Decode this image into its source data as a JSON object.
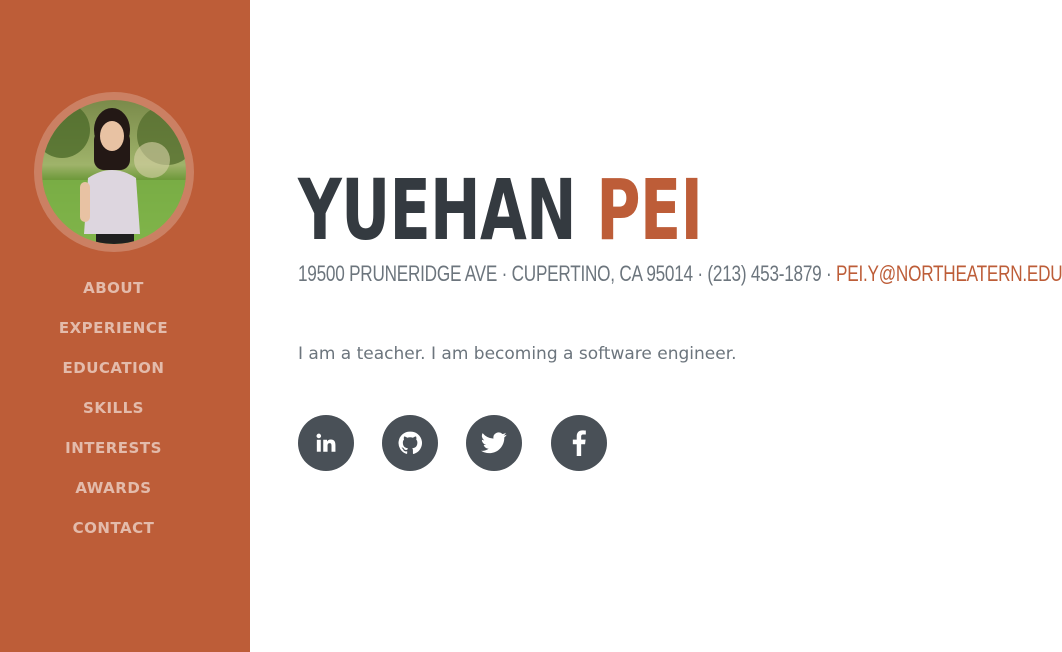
{
  "sidebar": {
    "avatar_alt": "Profile photo",
    "nav": [
      {
        "label": "ABOUT"
      },
      {
        "label": "EXPERIENCE"
      },
      {
        "label": "EDUCATION"
      },
      {
        "label": "SKILLS"
      },
      {
        "label": "INTERESTS"
      },
      {
        "label": "AWARDS"
      },
      {
        "label": "CONTACT"
      }
    ]
  },
  "about": {
    "first_name": "YUEHAN",
    "last_name": "PEI",
    "address": "19500 PRUNERIDGE AVE · CUPERTINO, CA 95014 · (213) 453-1879 · ",
    "email": "PEI.Y@NORTHEATERN.EDU",
    "lead": "I am a teacher. I am becoming a software engineer."
  },
  "social": [
    {
      "icon": "linkedin-icon"
    },
    {
      "icon": "github-icon"
    },
    {
      "icon": "twitter-icon"
    },
    {
      "icon": "facebook-icon"
    }
  ],
  "colors": {
    "primary": "#bd5d38",
    "heading": "#343a40",
    "muted": "#6c757d",
    "social_bg": "#495057"
  }
}
